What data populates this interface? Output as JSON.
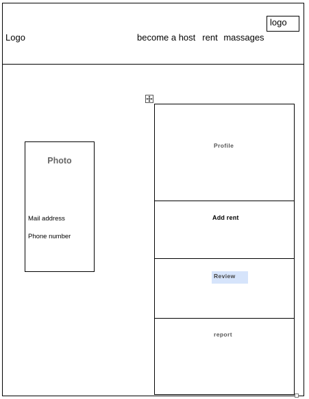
{
  "header": {
    "logo_label": "Logo",
    "logo_box_label": "logo",
    "nav": {
      "become_host": "become a host",
      "rent": "rent",
      "massages": "massages"
    }
  },
  "profile_card": {
    "photo_label": "Photo",
    "mail_label": "Mail address",
    "phone_label": "Phone number"
  },
  "menu": {
    "items": [
      {
        "label": "Profile"
      },
      {
        "label": "Add rent"
      },
      {
        "label": "Review"
      },
      {
        "label": "report"
      }
    ]
  },
  "colors": {
    "border": "#000000",
    "highlight": "#d6e4fb",
    "muted_text": "#555555"
  }
}
